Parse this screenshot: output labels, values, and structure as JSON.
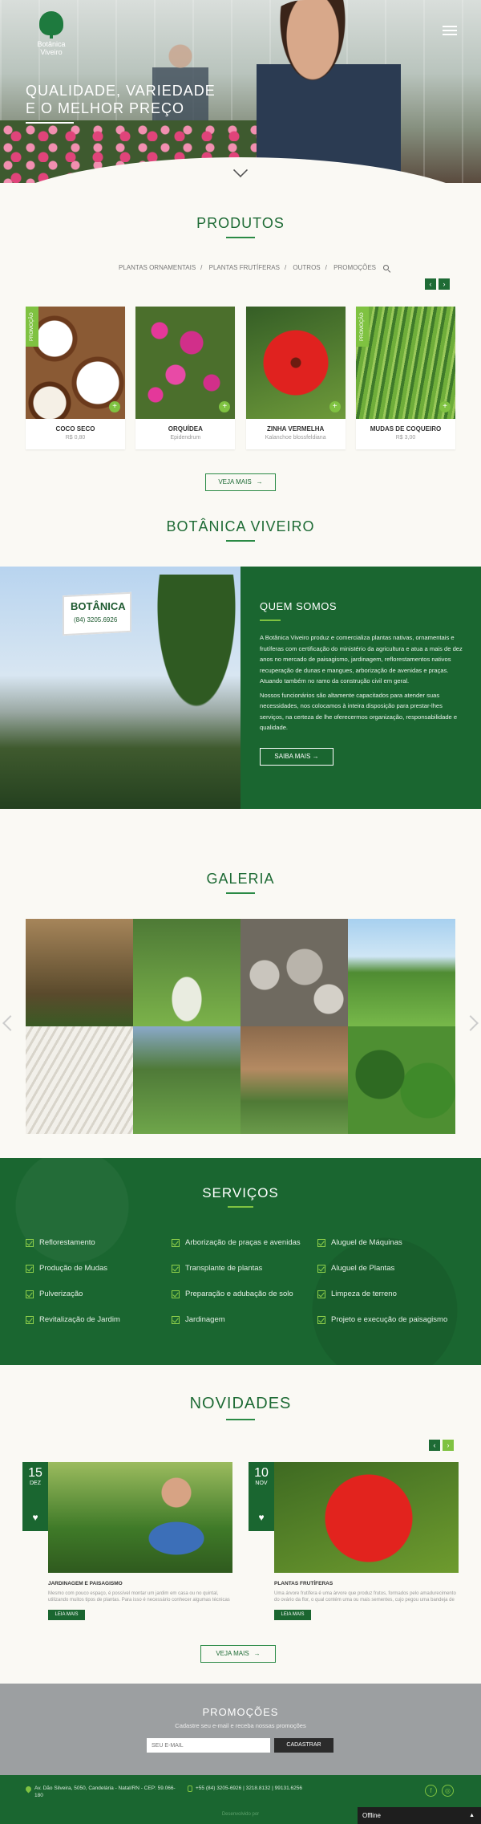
{
  "logo": {
    "text": "Botânica Viveiro"
  },
  "hero": {
    "title_line1": "QUALIDADE, VARIEDADE",
    "title_line2": "E O MELHOR PREÇO"
  },
  "products": {
    "title": "PRODUTOS",
    "filters": [
      "PLANTAS ORNAMENTAIS",
      "PLANTAS FRUTÍFERAS",
      "OUTROS",
      "PROMOÇÕES"
    ],
    "promo_label": "PROMOÇÃO",
    "items": [
      {
        "name": "COCO SECO",
        "sub": "R$ 0,80"
      },
      {
        "name": "ORQUÍDEA",
        "sub": "Epidendrum"
      },
      {
        "name": "ZINHA VERMELHA",
        "sub": "Kalanchoe blossfeldiana"
      },
      {
        "name": "MUDAS DE COQUEIRO",
        "sub": "R$ 3,00"
      }
    ],
    "more_label": "VEJA MAIS"
  },
  "about_section": {
    "title": "BOTÂNICA VIVEIRO"
  },
  "about": {
    "sign": "BOTÂNICA",
    "sign_phone": "(84) 3205.6926",
    "title": "QUEM SOMOS",
    "p1": "A Botânica Viveiro produz e comercializa plantas nativas, ornamentais e frutíferas com certificação do ministério da agricultura e atua a mais de dez anos no mercado de paisagismo, jardinagem, reflorestamentos nativos recuperação de dunas e mangues, arborização de avenidas e praças. Atuando também no ramo da construção civil em geral.",
    "p2": "Nossos funcionários são altamente capacitados para atender suas necessidades, nos colocamos à inteira disposição para prestar-lhes serviços, na certeza de lhe oferecermos organização, responsabilidade e qualidade.",
    "button": "SAIBA MAIS"
  },
  "gallery": {
    "title": "GALERIA"
  },
  "services": {
    "title": "SERVIÇOS",
    "items": [
      "Reflorestamento",
      "Arborização de praças e avenidas",
      "Aluguel de Máquinas",
      "Produção de Mudas",
      "Transplante de plantas",
      "Aluguel de Plantas",
      "Pulverização",
      "Preparação e adubação de solo",
      "Limpeza de terreno",
      "Revitalização de Jardim",
      "Jardinagem",
      "Projeto e execução de paisagismo"
    ]
  },
  "news": {
    "title": "NOVIDADES",
    "items": [
      {
        "day": "15",
        "month": "DEZ",
        "category": "JARDINAGEM E PAISAGISMO",
        "excerpt": "Mesmo com pouco espaço, é possível montar um jardim em casa ou no quintal, utilizando muitos tipos de plantas. Para isso é necessário conhecer algumas técnicas",
        "button": "LEIA MAIS"
      },
      {
        "day": "10",
        "month": "NOV",
        "category": "PLANTAS FRUTÍFERAS",
        "excerpt": "Uma árvore frutífera é uma árvore que produz frutos, formados pelo amadurecimento do ovário da flor, o qual contém uma ou mais sementes, cujo pegou uma bandeja de",
        "button": "LEIA MAIS"
      }
    ],
    "more_label": "VEJA MAIS"
  },
  "newsletter": {
    "title": "PROMOÇÕES",
    "subtitle": "Cadastre seu e-mail e receba nossas promoções",
    "placeholder": "SEU E-MAIL",
    "button": "CADASTRAR"
  },
  "footer": {
    "address": "Av. Dão Silveira, 5050, Candelária - Natal/RN - CEP: 59.066-180",
    "phones": "+55 (84) 3205-6926 | 3218.8132 | 99131.6256",
    "facebook": "f",
    "instagram": "◎",
    "credit": "Desenvolvido por"
  },
  "chat": {
    "label": "Offline"
  },
  "colors": {
    "primary": "#1a6630",
    "accent": "#7fc241",
    "background": "#faf9f4"
  }
}
